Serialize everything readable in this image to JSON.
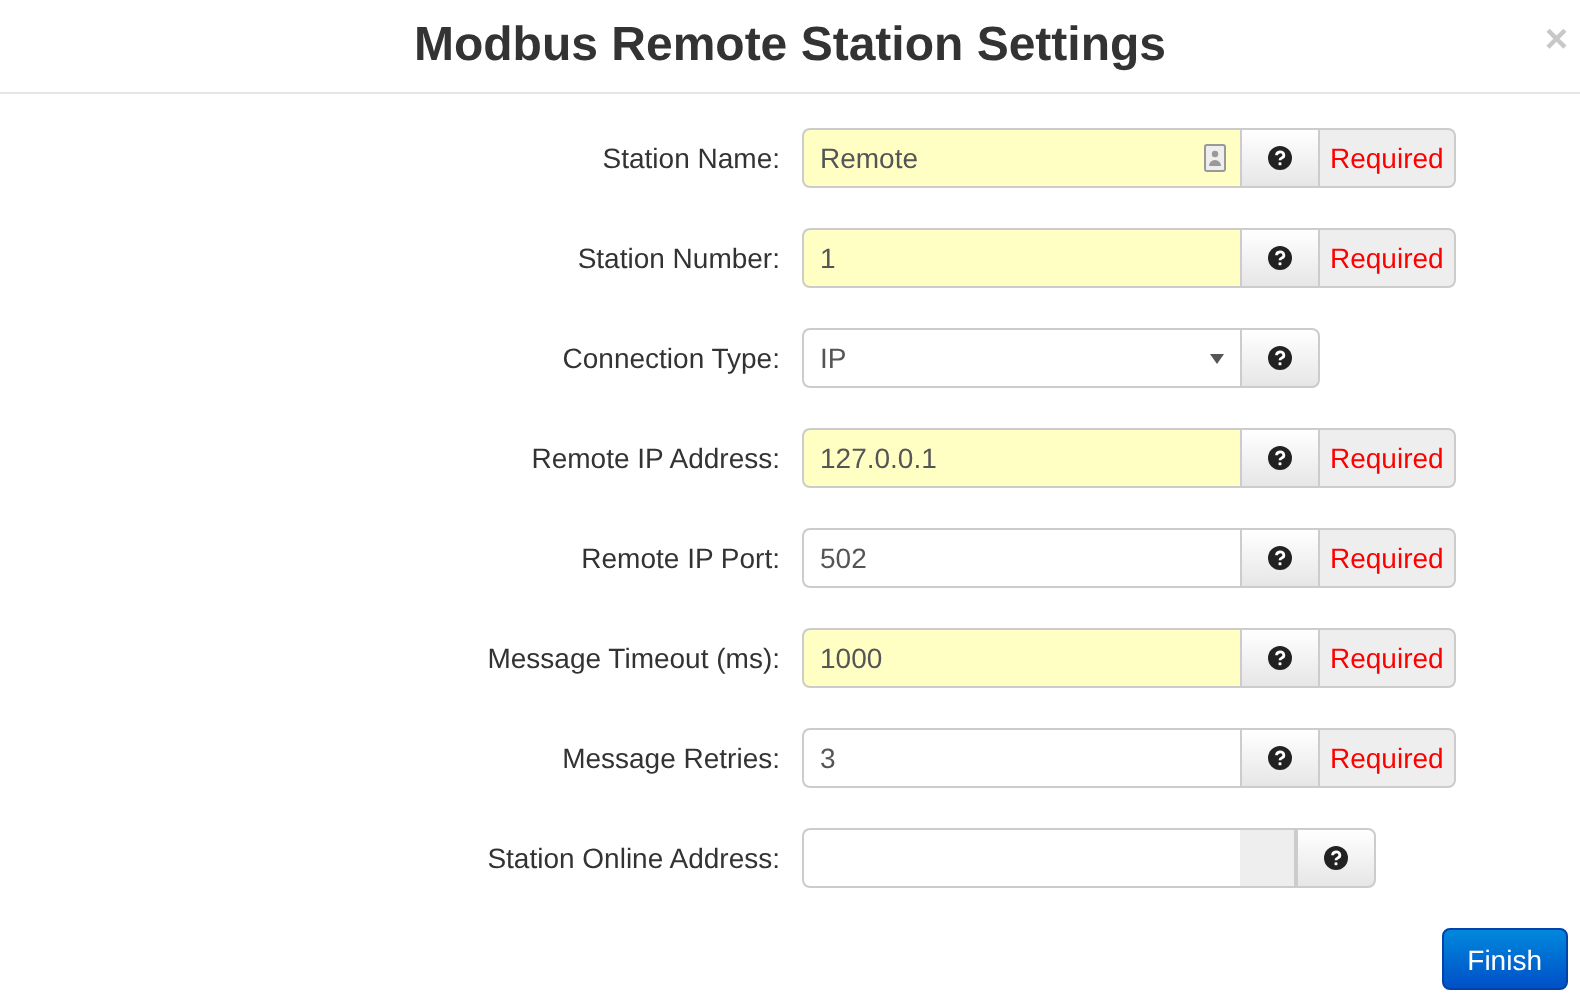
{
  "dialog": {
    "title": "Modbus Remote Station Settings",
    "close": "×"
  },
  "rows": [
    {
      "label": "Station Name:",
      "kind": "text",
      "value": "Remote",
      "highlighted": true,
      "autofill": true,
      "addon": {
        "kind": "status",
        "text": "Required"
      }
    },
    {
      "label": "Station Number:",
      "kind": "text",
      "value": "1",
      "highlighted": true,
      "autofill": false,
      "addon": {
        "kind": "status",
        "text": "Required"
      }
    },
    {
      "label": "Connection Type:",
      "kind": "select",
      "value": "IP",
      "highlighted": false,
      "autofill": false
    },
    {
      "label": "Remote IP Address:",
      "kind": "text",
      "value": "127.0.0.1",
      "highlighted": true,
      "autofill": false,
      "addon": {
        "kind": "status",
        "text": "Required"
      }
    },
    {
      "label": "Remote IP Port:",
      "kind": "text",
      "value": "502",
      "highlighted": false,
      "autofill": false,
      "addon": {
        "kind": "status",
        "text": "Required"
      }
    },
    {
      "label": "Message Timeout (ms):",
      "kind": "text",
      "value": "1000",
      "highlighted": true,
      "autofill": false,
      "addon": {
        "kind": "status",
        "text": "Required"
      }
    },
    {
      "label": "Message Retries:",
      "kind": "text",
      "value": "3",
      "highlighted": false,
      "autofill": false,
      "addon": {
        "kind": "status",
        "text": "Required"
      }
    },
    {
      "label": "Station Online Address:",
      "kind": "addon-before-help",
      "value": "",
      "highlighted": false,
      "autofill": false,
      "addon": {
        "kind": "blank"
      }
    }
  ],
  "finish": "Finish"
}
